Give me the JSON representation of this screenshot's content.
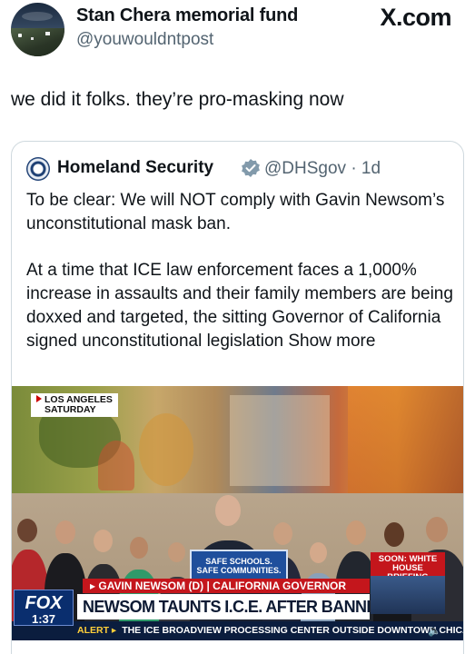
{
  "header": {
    "display_name": "Stan Chera memorial fund",
    "handle": "@youwouldntpost",
    "brand": "X.com"
  },
  "tweet": {
    "text": "we did it folks. they’re pro-masking now"
  },
  "quote": {
    "name": "Homeland Security",
    "handle_time": "@DHSgov · 1d",
    "paragraph1": "To be clear: We will NOT comply with Gavin Newsom’s unconstitutional mask ban.",
    "paragraph2": "At a time that ICE law enforcement faces a 1,000% increase in assaults and their family members are being doxxed and targeted, the sitting Governor of California signed unconstitutional legislation Show more",
    "verified_color": "#829aab"
  },
  "video": {
    "location_line1": "LOS ANGELES",
    "location_line2": "SATURDAY",
    "podium_line1": "SAFE SCHOOLS.",
    "podium_line2": "SAFE COMMUNITIES.",
    "soon": "SOON: WHITE HOUSE BRIEFING",
    "lower_third": "▸ GAVIN NEWSOM (D) | CALIFORNIA GOVERNOR",
    "headline": "NEWSOM TAUNTS I.C.E. AFTER BANNING FACE MASKS",
    "network": "FOX",
    "time": "1:37",
    "alert_label": "ALERT ▸",
    "alert_text": "THE ICE BROADVIEW PROCESSING CENTER OUTSIDE DOWNTOWN CHICAGO",
    "speaker_icon": "speaker-icon"
  }
}
